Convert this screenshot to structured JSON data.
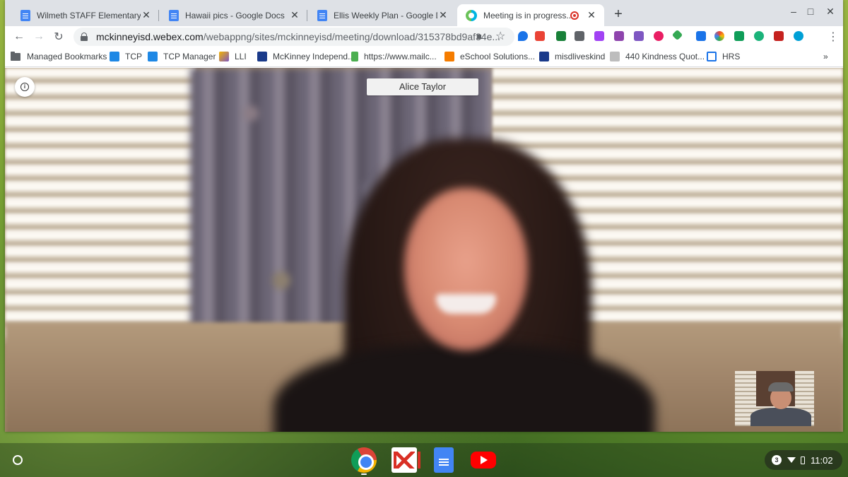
{
  "tabs": [
    {
      "title": "Wilmeth STAFF Elementary One",
      "icon": "docs-icon"
    },
    {
      "title": "Hawaii pics - Google Docs",
      "icon": "docs-icon"
    },
    {
      "title": "Ellis Weekly Plan - Google Docs",
      "icon": "docs-icon"
    },
    {
      "title": "Meeting is in progress...",
      "icon": "webex-icon",
      "recording": true
    }
  ],
  "omnibox": {
    "host": "mckinneyisd.webex.com",
    "path": "/webappng/sites/mckinneyisd/meeting/download/315378bd9af34e..."
  },
  "bookmarks": [
    {
      "label": "Managed Bookmarks",
      "icon": "folder-icon"
    },
    {
      "label": "TCP",
      "icon": "hourglass-icon"
    },
    {
      "label": "TCP Manager",
      "icon": "hourglass-icon"
    },
    {
      "label": "LLI",
      "icon": "lli-icon"
    },
    {
      "label": "McKinney Independ...",
      "icon": "m-icon"
    },
    {
      "label": "https://www.mailc...",
      "icon": "flag-icon"
    },
    {
      "label": "eSchool Solutions...",
      "icon": "sfe-icon"
    },
    {
      "label": "misdliveskind",
      "icon": "calendar-icon"
    },
    {
      "label": "440 Kindness Quot...",
      "icon": "w-icon"
    },
    {
      "label": "HRS",
      "icon": "window-icon"
    }
  ],
  "bookmarks_overflow": "»",
  "meeting": {
    "participant_name": "Alice Taylor",
    "info_glyph": "i"
  },
  "shelf": {
    "apps": [
      "chrome",
      "gmail",
      "google-docs",
      "youtube"
    ],
    "notification_count": "3",
    "time": "11:02"
  },
  "glyphs": {
    "close": "✕",
    "new_tab": "+",
    "minimize": "–",
    "maximize": "□",
    "win_close": "✕",
    "back": "←",
    "forward": "→",
    "reload": "↻",
    "star": "☆",
    "menu": "⋮",
    "camera": "■"
  }
}
